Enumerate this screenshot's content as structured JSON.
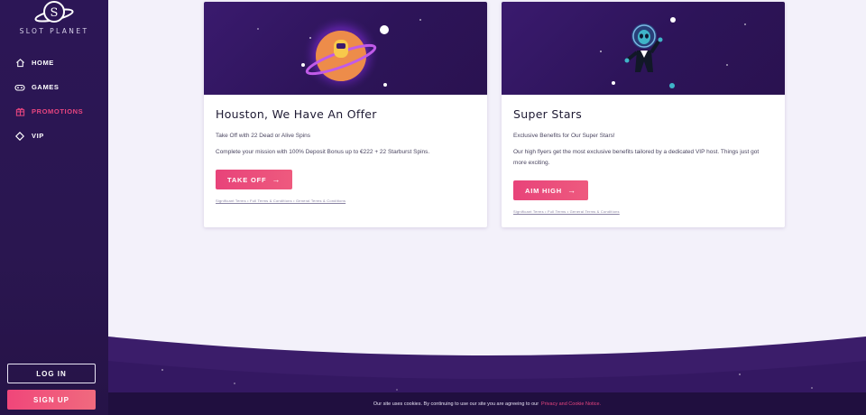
{
  "brand": {
    "logo_text": "SLOT PLANET"
  },
  "nav": {
    "items": [
      {
        "label": "HOME",
        "icon": "home-icon"
      },
      {
        "label": "GAMES",
        "icon": "gamepad-icon"
      },
      {
        "label": "PROMOTIONS",
        "icon": "gift-icon",
        "active": true
      },
      {
        "label": "VIP",
        "icon": "diamond-icon"
      }
    ]
  },
  "auth": {
    "login_label": "LOG IN",
    "signup_label": "SIGN UP"
  },
  "promotions": [
    {
      "title": "Houston, We Have An Offer",
      "subtitle": "Take Off with 22 Dead or Alive Spins",
      "description": "Complete your mission with 100% Deposit Bonus up to €222 + 22 Starburst Spins.",
      "cta": "TAKE OFF",
      "terms": "Significant Terms • Full Terms & Conditions • General Terms & Conditions"
    },
    {
      "title": "Super Stars",
      "subtitle": "Exclusive Benefits for Our Super Stars!",
      "description": "Our high flyers get the most exclusive benefits tailored by a dedicated VIP host. Things just got more exciting.",
      "cta": "AIM HIGH",
      "terms": "Significant Terms • Full Terms • General Terms & Conditions"
    }
  ],
  "cookie": {
    "text": "Our site uses cookies. By continuing to use our site you are agreeing to our",
    "link": "Privacy and Cookie Notice."
  },
  "colors": {
    "accent": "#e8457f",
    "sidebar": "#2c1656",
    "hero": "#2d1459"
  }
}
